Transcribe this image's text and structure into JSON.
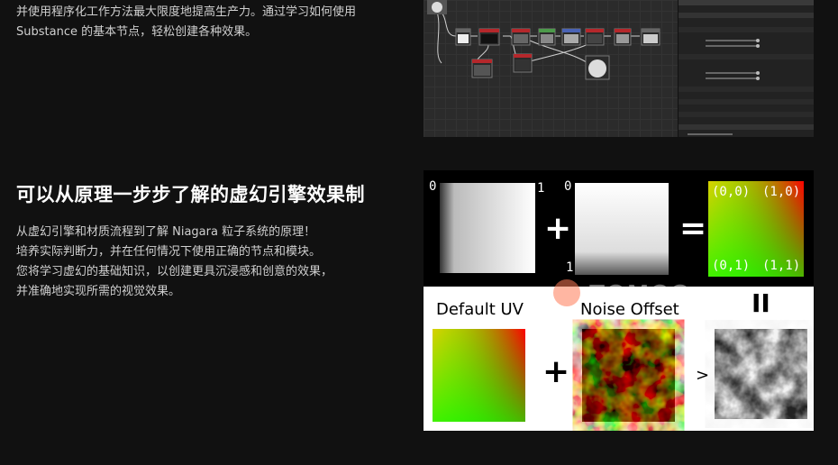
{
  "intro_text": {
    "line1": "并使用程序化工作方法最大限度地提高生产力。通过学习如何使用",
    "line2": "Substance 的基本节点，轻松创建各种效果。"
  },
  "section_title": "可以从原理一步步了解的虚幻引擎效果制",
  "body_text": {
    "line1": "从虚幻引擎和材质流程到了解 Niagara 粒子系统的原理！",
    "line2": "培养实际判断力，并在任何情况下使用正确的节点和模块。",
    "line3": "您将学习虚幻的基础知识，以创建更具沉浸感和创意的效果，",
    "line4": "并准确地实现所需的视觉效果。"
  },
  "uv_diagram": {
    "label_0_left": "0",
    "label_1_left": "1",
    "label_0_mid": "0",
    "label_1_mid": "1",
    "plus": "+",
    "equals": "=",
    "corner_tl": "(0,0)",
    "corner_tr": "(1,0)",
    "corner_bl": "(0,1)",
    "corner_br": "(1,1)",
    "default_uv": "Default UV",
    "noise_offset": "Noise Offset",
    "plus2": "+",
    "greater": ">",
    "parallel": "II"
  },
  "watermark": "TOMCG",
  "colors": {
    "background": "#111111",
    "node_red": "#b5272b",
    "node_green": "#4c9a4a",
    "node_blue": "#4a63b5",
    "uv_red": "#ff0000",
    "uv_green": "#00ff00"
  }
}
